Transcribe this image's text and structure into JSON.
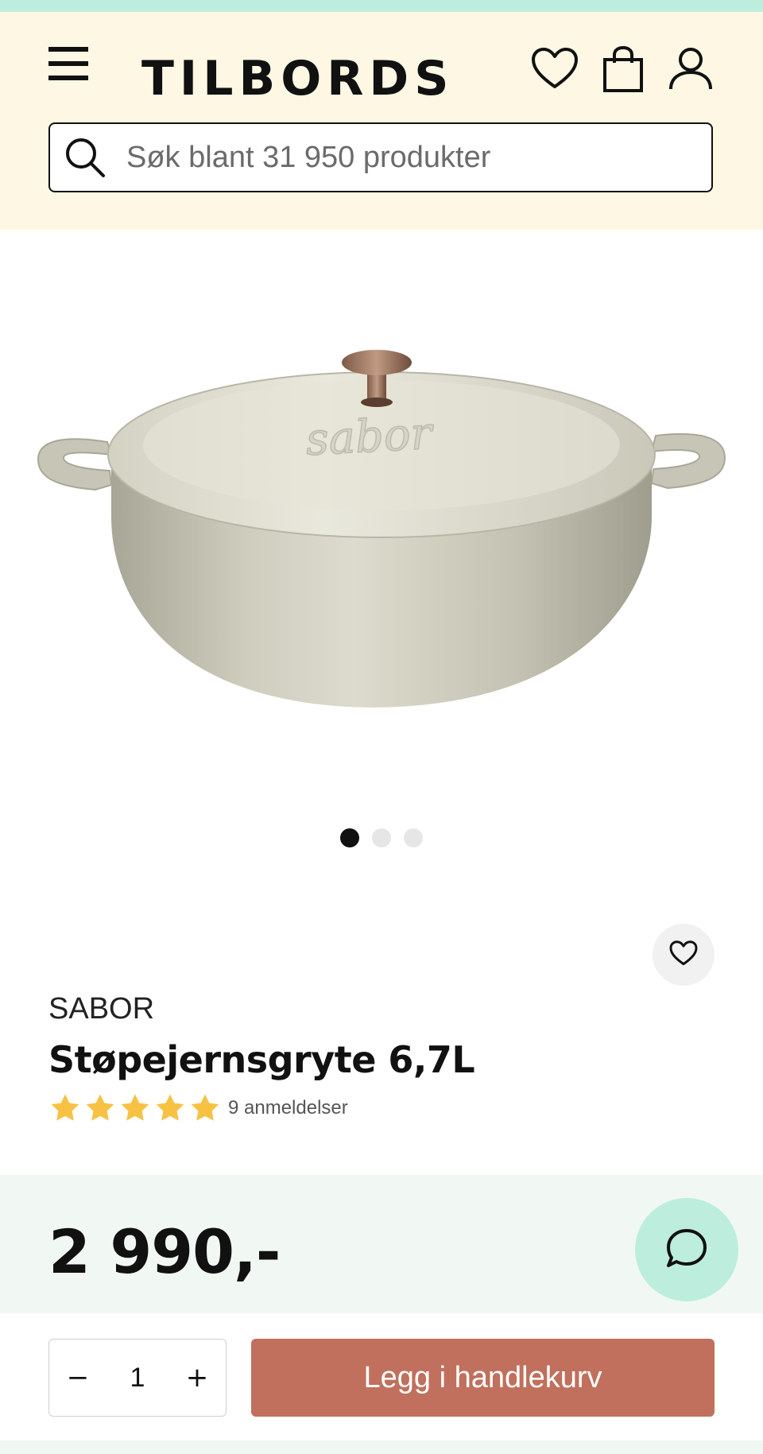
{
  "header": {
    "logo_text": "TILBORDS",
    "search_placeholder": "Søk blant 31 950 produkter",
    "icons": [
      "menu-icon",
      "heart-icon",
      "shopping-bag-icon",
      "user-icon",
      "search-icon"
    ],
    "accent_strip_color": "#bdeedd",
    "background_color": "#fdf7e4"
  },
  "gallery": {
    "image": "product-photo-pot",
    "image_count": 3,
    "active_index": 0
  },
  "product": {
    "brand": "SABOR",
    "title": "Støpejernsgryte 6,7L",
    "rating": 5,
    "rating_max": 5,
    "reviews_label": "9 anmeldelser",
    "price": "2 990,-"
  },
  "purchase": {
    "quantity": "1",
    "minus_label": "−",
    "plus_label": "+",
    "add_to_cart_label": "Legg i handlekurv",
    "button_color": "#c0705c"
  },
  "chat": {
    "icon": "chat-icon",
    "color": "#bdeedd"
  }
}
